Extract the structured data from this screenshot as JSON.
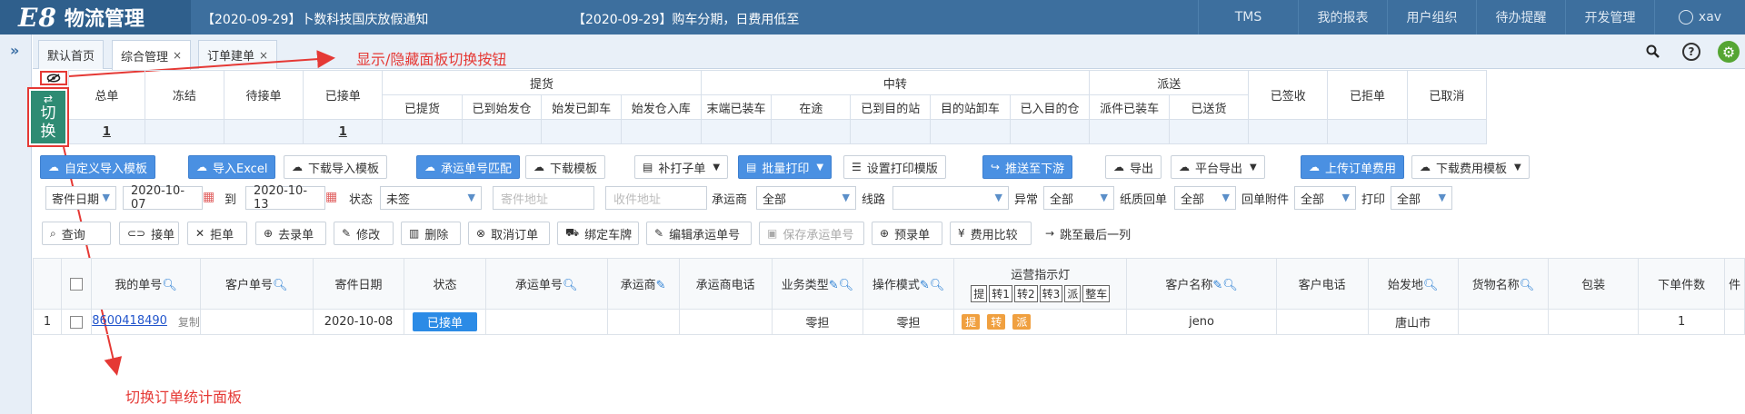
{
  "app": {
    "logo_mark": "E8",
    "logo_text": "物流管理"
  },
  "notices": [
    "【2020-09-29】卜数科技国庆放假通知",
    "【2020-09-29】购车分期，日费用低至"
  ],
  "top_nav": [
    "TMS",
    "我的报表",
    "用户组织",
    "待办提醒",
    "开发管理",
    "xav"
  ],
  "tabs": [
    {
      "label": "默认首页",
      "closable": false
    },
    {
      "label": "综合管理",
      "closable": true,
      "active": true
    },
    {
      "label": "订单建单",
      "closable": true
    }
  ],
  "tab_close_glyph": "×",
  "annotations": {
    "toggle_panel": "显示/隐藏面板切换按钮",
    "switch_stats": "切换订单统计面板"
  },
  "switch_button": {
    "line1": "切",
    "line2": "换"
  },
  "stats": {
    "groups": {
      "pickup": "提货",
      "transit": "中转",
      "dispatch": "派送"
    },
    "headers": [
      "总单",
      "冻结",
      "待接单",
      "已接单",
      "已提货",
      "已到始发仓",
      "始发已卸车",
      "始发仓入库",
      "末端已装车",
      "在途",
      "已到目的站",
      "目的站卸车",
      "已入目的仓",
      "派件已装车",
      "已送货",
      "已签收",
      "已拒单",
      "已取消"
    ],
    "values": [
      "1",
      "",
      "",
      "1",
      "",
      "",
      "",
      "",
      "",
      "",
      "",
      "",
      "",
      "",
      "",
      "",
      "",
      ""
    ]
  },
  "toolbar1": {
    "custom_import": "自定义导入模板",
    "import_excel": "导入Excel",
    "download_import": "下载导入模板",
    "carrier_match": "承运单号匹配",
    "download_template": "下载模板",
    "reprint": "补打子单",
    "batch_print": "批量打印",
    "print_template": "设置打印模版",
    "push_down": "推送至下游",
    "export": "导出",
    "platform_export": "平台导出",
    "upload_fee": "上传订单费用",
    "download_fee": "下载费用模板"
  },
  "filters": {
    "date_type": "寄件日期",
    "date_from": "2020-10-07",
    "to": "到",
    "date_to": "2020-10-13",
    "status_label": "状态",
    "status_value": "未签",
    "sender_addr_ph": "寄件地址",
    "receiver_addr_ph": "收件地址",
    "carrier_label": "承运商",
    "carrier_value": "全部",
    "route_label": "线路",
    "route_value": "",
    "abnormal_label": "异常",
    "abnormal_value": "全部",
    "paper_receipt_label": "纸质回单",
    "paper_receipt_value": "全部",
    "receipt_attach_label": "回单附件",
    "receipt_attach_value": "全部",
    "print_label": "打印",
    "print_value": "全部"
  },
  "toolbar2": {
    "query": "查询",
    "accept": "接单",
    "reject": "拒单",
    "to_entry": "去录单",
    "modify": "修改",
    "delete": "删除",
    "cancel_order": "取消订单",
    "bind_plate": "绑定车牌",
    "edit_carrier_no": "编辑承运单号",
    "save_carrier_no": "保存承运单号",
    "pre_entry": "预录单",
    "fee_compare": "费用比较",
    "jump_last": "跳至最后一列"
  },
  "grid": {
    "headers": {
      "my_no": "我的单号",
      "customer_no": "客户单号",
      "send_date": "寄件日期",
      "status": "状态",
      "carrier_no": "承运单号",
      "carrier": "承运商",
      "carrier_phone": "承运商电话",
      "biz_type": "业务类型",
      "op_mode": "操作模式",
      "ops_light": "运营指示灯",
      "customer_name": "客户名称",
      "customer_phone": "客户电话",
      "origin": "始发地",
      "goods_name": "货物名称",
      "packing": "包装",
      "order_qty": "下单件数",
      "more": "件"
    },
    "lights": [
      "提",
      "转1",
      "转2",
      "转3",
      "派",
      "整车"
    ],
    "rows": [
      {
        "index": "1",
        "my_no": "8600418490",
        "copy": "复制",
        "customer_no": "",
        "send_date": "2020-10-08",
        "status": "已接单",
        "carrier_no": "",
        "carrier": "",
        "carrier_phone": "",
        "biz_type": "零担",
        "op_mode": "零担",
        "lights_on": [
          "提",
          "转",
          "派"
        ],
        "customer_name": "jeno",
        "customer_phone": "",
        "origin": "唐山市",
        "goods_name": "",
        "packing": "",
        "order_qty": "1"
      }
    ]
  }
}
